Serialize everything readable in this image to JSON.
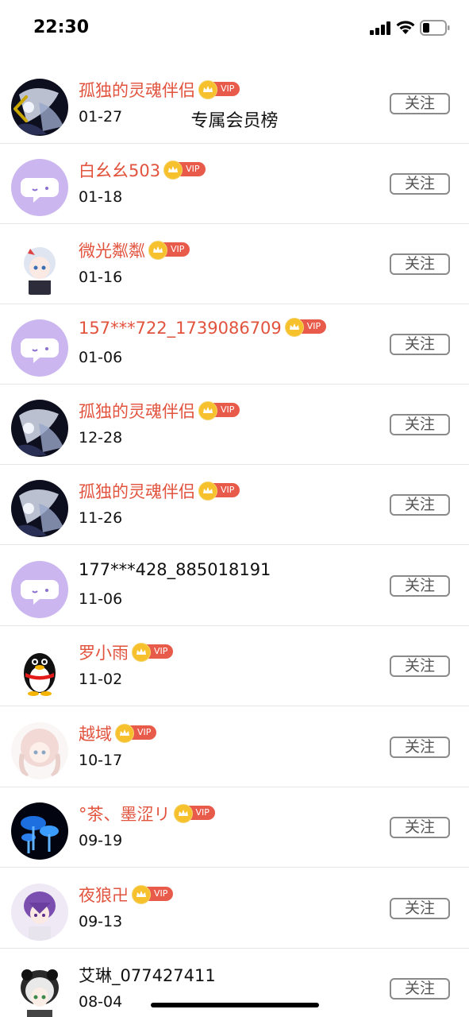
{
  "status_bar": {
    "time": "22:30"
  },
  "header": {
    "title": "专属会员榜"
  },
  "badge_text": "VIP",
  "follow_label": "关注",
  "members": [
    {
      "name": "孤独的灵魂伴侣",
      "date": "01-27",
      "vip": true,
      "avatar": "dark-floral"
    },
    {
      "name": "白幺幺503",
      "date": "01-18",
      "vip": true,
      "avatar": "default-chat"
    },
    {
      "name": "微光粼粼",
      "date": "01-16",
      "vip": true,
      "avatar": "anime-girl-white-hair"
    },
    {
      "name": "157***722_1739086709",
      "date": "01-06",
      "vip": true,
      "avatar": "default-chat"
    },
    {
      "name": "孤独的灵魂伴侣",
      "date": "12-28",
      "vip": true,
      "avatar": "dark-floral"
    },
    {
      "name": "孤独的灵魂伴侣",
      "date": "11-26",
      "vip": true,
      "avatar": "dark-floral"
    },
    {
      "name": "177***428_885018191",
      "date": "11-06",
      "vip": false,
      "avatar": "default-chat"
    },
    {
      "name": "罗小雨",
      "date": "11-02",
      "vip": true,
      "avatar": "qq-penguin"
    },
    {
      "name": "越域",
      "date": "10-17",
      "vip": true,
      "avatar": "anime-girl-pink-hair"
    },
    {
      "name": "°茶、墨涩リ",
      "date": "09-19",
      "vip": true,
      "avatar": "blue-mushrooms"
    },
    {
      "name": "夜狼卍",
      "date": "09-13",
      "vip": true,
      "avatar": "anime-boy-purple-hair"
    },
    {
      "name": "艾琳_077427411",
      "date": "08-04",
      "vip": false,
      "avatar": "anime-panda-hood"
    }
  ]
}
